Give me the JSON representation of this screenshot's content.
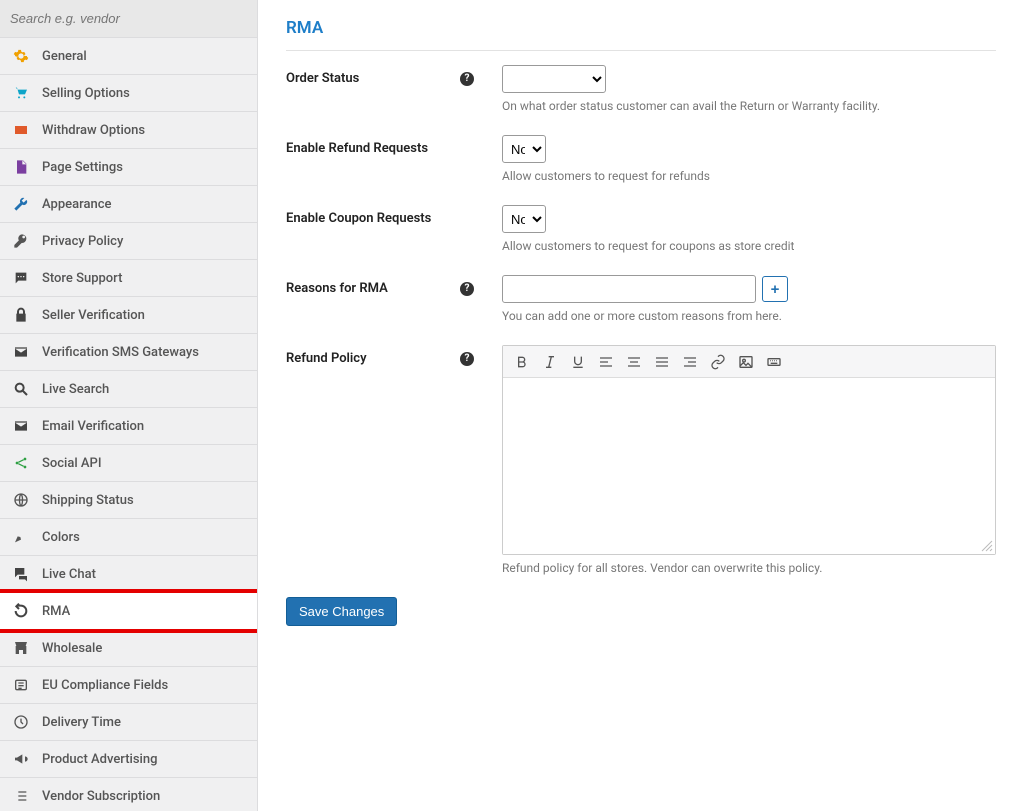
{
  "sidebar": {
    "search_placeholder": "Search e.g. vendor",
    "items": [
      {
        "icon": "gear",
        "color": "#f0a000",
        "label": "General"
      },
      {
        "icon": "cart",
        "color": "#0ea5c9",
        "label": "Selling Options"
      },
      {
        "icon": "wallet",
        "color": "#e05a2b",
        "label": "Withdraw Options"
      },
      {
        "icon": "page",
        "color": "#7b3fa0",
        "label": "Page Settings"
      },
      {
        "icon": "wrench",
        "color": "#2271b1",
        "label": "Appearance"
      },
      {
        "icon": "key",
        "color": "#555",
        "label": "Privacy Policy"
      },
      {
        "icon": "chat",
        "color": "#444",
        "label": "Store Support"
      },
      {
        "icon": "lock",
        "color": "#444",
        "label": "Seller Verification"
      },
      {
        "icon": "mail",
        "color": "#444",
        "label": "Verification SMS Gateways"
      },
      {
        "icon": "search",
        "color": "#444",
        "label": "Live Search"
      },
      {
        "icon": "mail",
        "color": "#444",
        "label": "Email Verification"
      },
      {
        "icon": "share",
        "color": "#2ea043",
        "label": "Social API"
      },
      {
        "icon": "globe",
        "color": "#555",
        "label": "Shipping Status"
      },
      {
        "icon": "brush",
        "color": "#555",
        "label": "Colors"
      },
      {
        "icon": "comments",
        "color": "#444",
        "label": "Live Chat"
      },
      {
        "icon": "undo",
        "color": "#444",
        "label": "RMA",
        "highlighted": true
      },
      {
        "icon": "store",
        "color": "#555",
        "label": "Wholesale"
      },
      {
        "icon": "badge",
        "color": "#555",
        "label": "EU Compliance Fields"
      },
      {
        "icon": "clock",
        "color": "#555",
        "label": "Delivery Time"
      },
      {
        "icon": "megaphone",
        "color": "#555",
        "label": "Product Advertising"
      },
      {
        "icon": "list",
        "color": "#555",
        "label": "Vendor Subscription"
      }
    ]
  },
  "page": {
    "title": "RMA",
    "save_label": "Save Changes"
  },
  "form": {
    "order_status": {
      "label": "Order Status",
      "help": true,
      "value": "",
      "hint": "On what order status customer can avail the Return or Warranty facility."
    },
    "enable_refund": {
      "label": "Enable Refund Requests",
      "value": "No",
      "hint": "Allow customers to request for refunds"
    },
    "enable_coupon": {
      "label": "Enable Coupon Requests",
      "value": "No",
      "hint": "Allow customers to request for coupons as store credit"
    },
    "reasons": {
      "label": "Reasons for RMA",
      "help": true,
      "value": "",
      "hint": "You can add one or more custom reasons from here.",
      "add_label": "+"
    },
    "refund_policy": {
      "label": "Refund Policy",
      "help": true,
      "value": "",
      "hint": "Refund policy for all stores. Vendor can overwrite this policy."
    }
  }
}
